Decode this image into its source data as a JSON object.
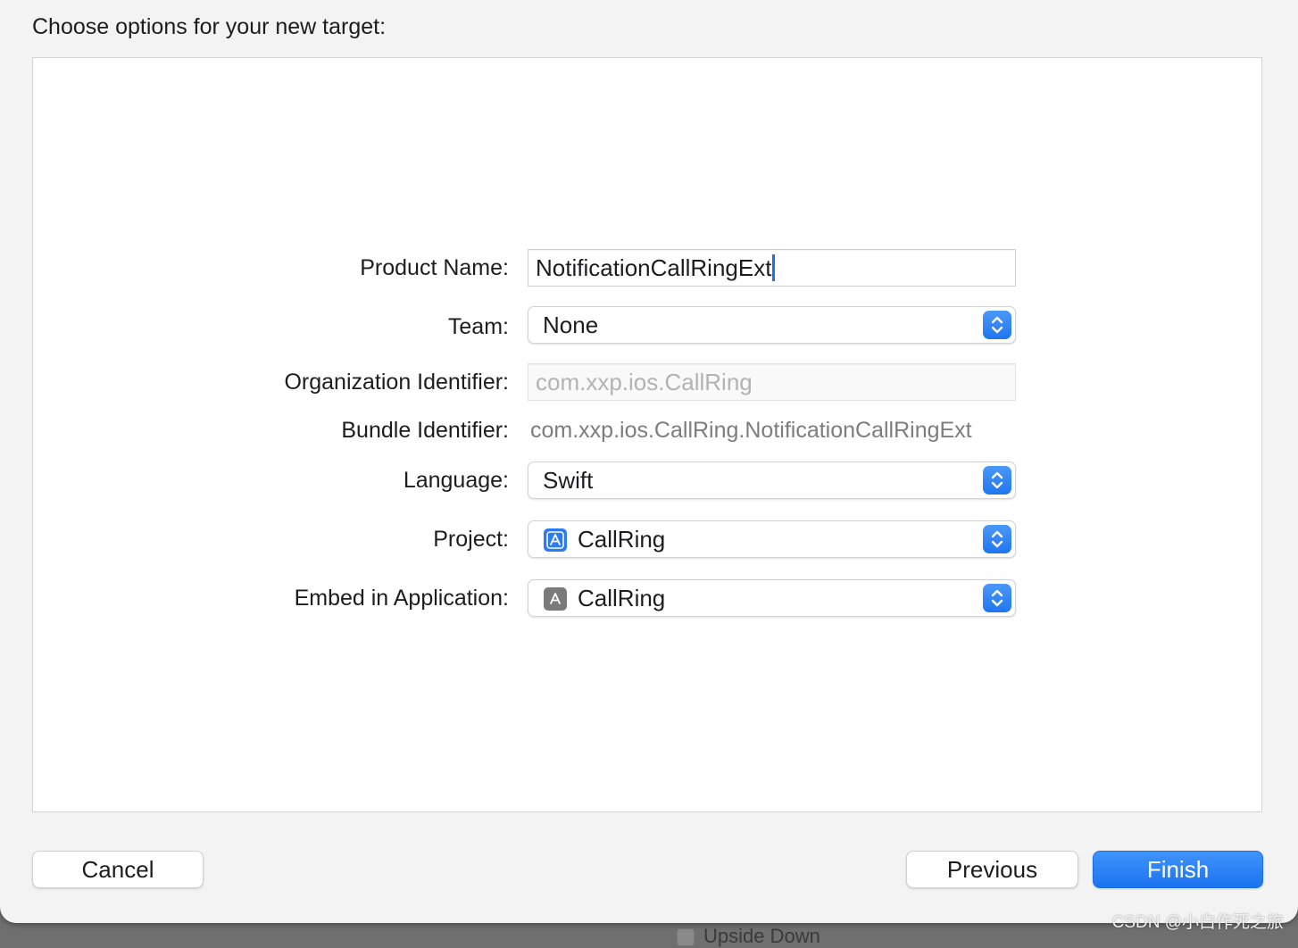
{
  "dialog": {
    "heading": "Choose options for your new target:"
  },
  "form": {
    "product_name": {
      "label": "Product Name:",
      "value": "NotificationCallRingExt"
    },
    "team": {
      "label": "Team:",
      "value": "None"
    },
    "organization_identifier": {
      "label": "Organization Identifier:",
      "placeholder": "com.xxp.ios.CallRing"
    },
    "bundle_identifier": {
      "label": "Bundle Identifier:",
      "value": "com.xxp.ios.CallRing.NotificationCallRingExt"
    },
    "language": {
      "label": "Language:",
      "value": "Swift"
    },
    "project": {
      "label": "Project:",
      "value": "CallRing",
      "icon": "xcode-project-icon"
    },
    "embed_in_application": {
      "label": "Embed in Application:",
      "value": "CallRing",
      "icon": "app-target-icon"
    }
  },
  "buttons": {
    "cancel": "Cancel",
    "previous": "Previous",
    "finish": "Finish"
  },
  "background": {
    "partial_text": "Upside Down"
  },
  "watermark": "CSDN @小白作死之旅",
  "colors": {
    "accent": "#1f76ee",
    "sheet_background": "#f3f3f3",
    "panel_background": "#ffffff"
  }
}
